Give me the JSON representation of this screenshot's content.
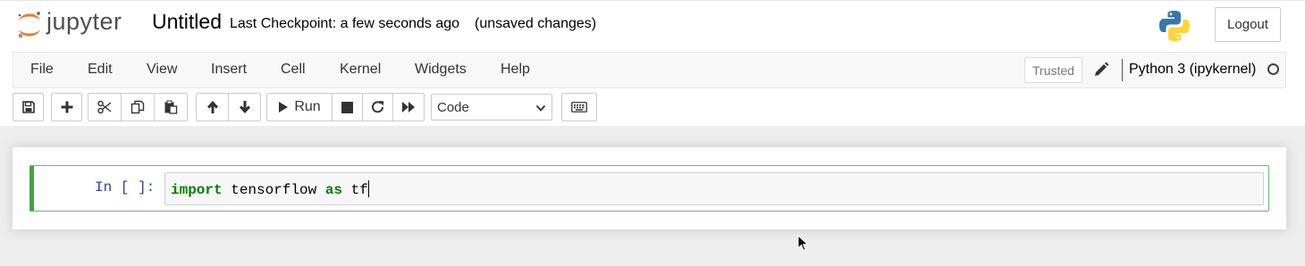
{
  "header": {
    "logo_text": "jupyter",
    "notebook_name": "Untitled",
    "checkpoint": "Last Checkpoint: a few seconds ago",
    "autosave_status": "(unsaved changes)",
    "logout_label": "Logout"
  },
  "menubar": {
    "items": [
      "File",
      "Edit",
      "View",
      "Insert",
      "Cell",
      "Kernel",
      "Widgets",
      "Help"
    ],
    "trusted_label": "Trusted",
    "kernel_name": "Python 3 (ipykernel)"
  },
  "toolbar": {
    "buttons": [
      "save-icon",
      "plus-icon",
      "cut-icon",
      "copy-icon",
      "paste-icon",
      "arrow-up-icon",
      "arrow-down-icon",
      "run-icon",
      "stop-icon",
      "restart-icon",
      "fast-forward-icon",
      "keyboard-icon"
    ],
    "run_label": "Run",
    "cell_type": "Code"
  },
  "cell": {
    "prompt": "In [ ]:",
    "code_keyword_1": "import",
    "code_text_1": " tensorflow ",
    "code_keyword_2": "as",
    "code_text_2": " tf"
  },
  "colors": {
    "selected_cell_border": "#42a542",
    "prompt_color": "#303f9f",
    "keyword_color": "#008000",
    "logo_orange": "#f37726"
  }
}
